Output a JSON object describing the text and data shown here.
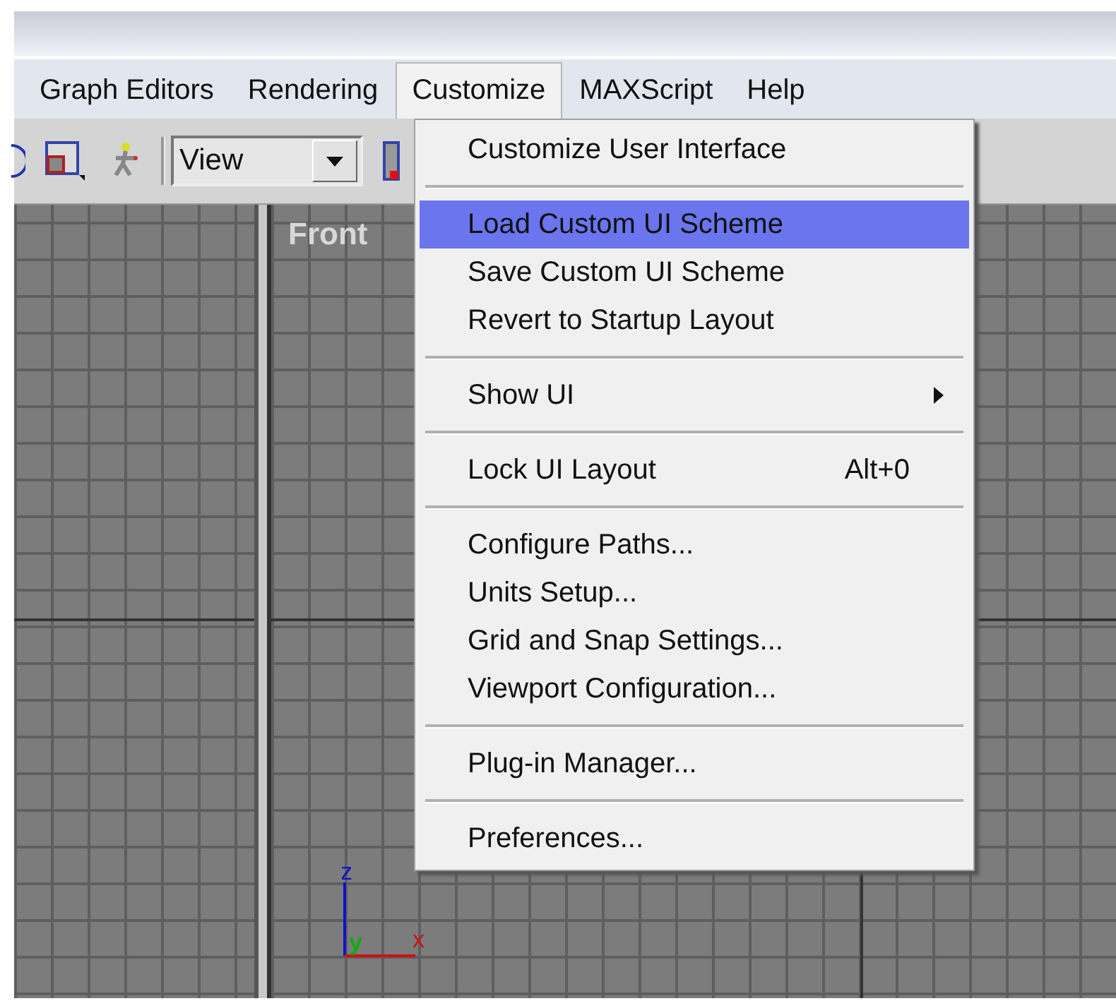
{
  "menubar": [
    {
      "label": "Graph Editors",
      "selected": false
    },
    {
      "label": "Rendering",
      "selected": false
    },
    {
      "label": "Customize",
      "selected": true
    },
    {
      "label": "MAXScript",
      "selected": false
    },
    {
      "label": "Help",
      "selected": false
    }
  ],
  "toolbar": {
    "view_dropdown": {
      "value": "View"
    }
  },
  "front_viewport": {
    "label": "Front"
  },
  "axes": {
    "z": "z",
    "y": "y",
    "x": "x"
  },
  "menu": {
    "sections": [
      [
        {
          "kind": "command",
          "label": "Customize User Interface",
          "selected": false
        }
      ],
      [
        {
          "kind": "command",
          "label": "Load Custom UI Scheme",
          "selected": true
        },
        {
          "kind": "command",
          "label": "Save Custom UI Scheme",
          "selected": false
        },
        {
          "kind": "command",
          "label": "Revert to Startup Layout",
          "selected": false
        }
      ],
      [
        {
          "kind": "submenu",
          "label": "Show UI",
          "selected": false
        }
      ],
      [
        {
          "kind": "command",
          "label": "Lock UI Layout",
          "shortcut": "Alt+0",
          "selected": false
        }
      ],
      [
        {
          "kind": "command",
          "label": "Configure Paths...",
          "selected": false
        },
        {
          "kind": "command",
          "label": "Units Setup...",
          "selected": false
        },
        {
          "kind": "command",
          "label": "Grid and Snap Settings...",
          "selected": false
        },
        {
          "kind": "command",
          "label": "Viewport Configuration...",
          "selected": false
        }
      ],
      [
        {
          "kind": "command",
          "label": "Plug-in Manager...",
          "selected": false
        }
      ],
      [
        {
          "kind": "command",
          "label": "Preferences...",
          "selected": false
        }
      ]
    ]
  }
}
